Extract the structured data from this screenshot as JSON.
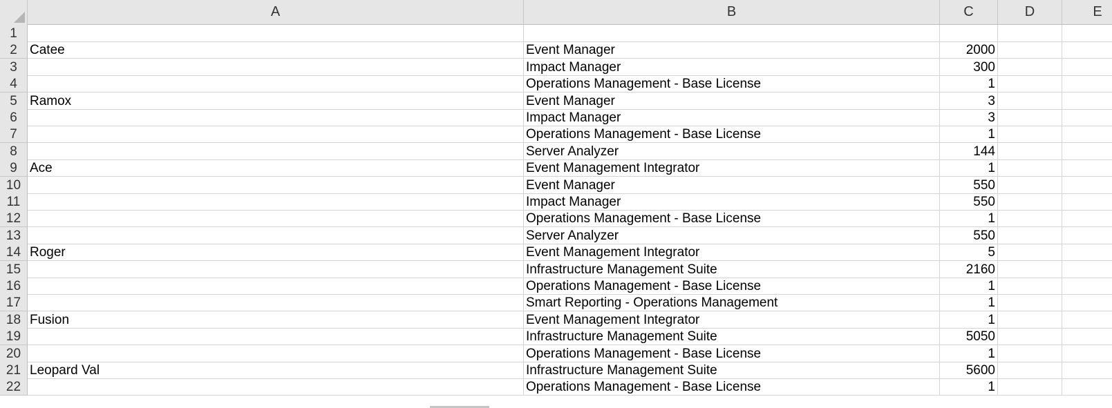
{
  "columns": [
    "A",
    "B",
    "C",
    "D",
    "E"
  ],
  "rows": [
    {
      "num": "1",
      "a": "",
      "b": "",
      "c": ""
    },
    {
      "num": "2",
      "a": "Catee",
      "b": "Event Manager",
      "c": "2000"
    },
    {
      "num": "3",
      "a": "",
      "b": "Impact Manager",
      "c": "300"
    },
    {
      "num": "4",
      "a": "",
      "b": "Operations Management - Base License",
      "c": "1"
    },
    {
      "num": "5",
      "a": "Ramox",
      "b": "Event Manager",
      "c": "3"
    },
    {
      "num": "6",
      "a": "",
      "b": "Impact Manager",
      "c": "3"
    },
    {
      "num": "7",
      "a": "",
      "b": "Operations Management - Base License",
      "c": "1"
    },
    {
      "num": "8",
      "a": "",
      "b": "Server Analyzer",
      "c": "144"
    },
    {
      "num": "9",
      "a": "Ace",
      "b": "Event Management Integrator",
      "c": "1"
    },
    {
      "num": "10",
      "a": "",
      "b": "Event Manager",
      "c": "550"
    },
    {
      "num": "11",
      "a": "",
      "b": "Impact Manager",
      "c": "550"
    },
    {
      "num": "12",
      "a": "",
      "b": "Operations Management - Base License",
      "c": "1"
    },
    {
      "num": "13",
      "a": "",
      "b": "Server Analyzer",
      "c": "550"
    },
    {
      "num": "14",
      "a": "Roger",
      "b": "Event Management Integrator",
      "c": "5"
    },
    {
      "num": "15",
      "a": "",
      "b": "Infrastructure Management Suite",
      "c": "2160"
    },
    {
      "num": "16",
      "a": "",
      "b": "Operations Management - Base License",
      "c": "1"
    },
    {
      "num": "17",
      "a": "",
      "b": "Smart Reporting - Operations Management",
      "c": "1"
    },
    {
      "num": "18",
      "a": "Fusion",
      "b": "Event Management Integrator",
      "c": "1"
    },
    {
      "num": "19",
      "a": "",
      "b": "Infrastructure Management Suite",
      "c": "5050"
    },
    {
      "num": "20",
      "a": "",
      "b": "Operations Management - Base License",
      "c": "1"
    },
    {
      "num": "21",
      "a": "Leopard Val",
      "b": "Infrastructure Management Suite",
      "c": "5600"
    },
    {
      "num": "22",
      "a": "",
      "b": "Operations Management - Base License",
      "c": "1"
    }
  ]
}
